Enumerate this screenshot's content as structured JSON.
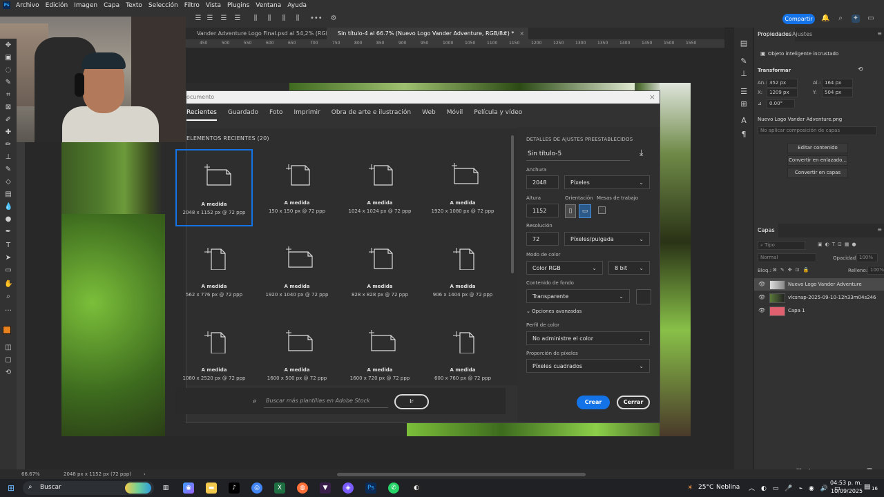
{
  "menubar": {
    "app_icon_label": "Ps",
    "menus": [
      "Archivo",
      "Edición",
      "Imagen",
      "Capa",
      "Texto",
      "Selección",
      "Filtro",
      "Vista",
      "Plugins",
      "Ventana",
      "Ayuda"
    ]
  },
  "options": {
    "share_label": "Compartir"
  },
  "doc_tabs": [
    {
      "label": "Vander Adventure Logo Final.psd al 54,2% (RGB/8#)",
      "active": false
    },
    {
      "label": "Sin título-4 al 66.7% (Nuevo Logo Vander Adventure, RGB/8#) *",
      "active": true
    }
  ],
  "ruler_ticks": [
    "450",
    "500",
    "550",
    "600",
    "650",
    "700",
    "750",
    "800",
    "850",
    "900",
    "950",
    "1000",
    "1050",
    "1100",
    "1150",
    "1200",
    "1250",
    "1300",
    "1350",
    "1400",
    "1450",
    "1500",
    "1550"
  ],
  "dialog": {
    "title": "ocumento",
    "tabs": [
      "Recientes",
      "Guardado",
      "Foto",
      "Imprimir",
      "Obra de arte e ilustración",
      "Web",
      "Móvil",
      "Película y vídeo"
    ],
    "recent_header": "ELEMENTOS RECIENTES",
    "recent_count": "(20)",
    "presets": [
      {
        "name": "A medida",
        "size": "2048 x 1152 px @ 72 ppp",
        "selected": true,
        "shape": "landscape"
      },
      {
        "name": "A medida",
        "size": "150 x 150 px @ 72 ppp",
        "selected": false,
        "shape": "square"
      },
      {
        "name": "A medida",
        "size": "1024 x 1024 px @ 72 ppp",
        "selected": false,
        "shape": "square"
      },
      {
        "name": "A medida",
        "size": "1920 x 1080 px @ 72 ppp",
        "selected": false,
        "shape": "landscape"
      },
      {
        "name": "A medida",
        "size": "562 x 776 px @ 72 ppp",
        "selected": false,
        "shape": "portrait"
      },
      {
        "name": "A medida",
        "size": "1920 x 1040 px @ 72 ppp",
        "selected": false,
        "shape": "landscape"
      },
      {
        "name": "A medida",
        "size": "828 x 828 px @ 72 ppp",
        "selected": false,
        "shape": "square"
      },
      {
        "name": "A medida",
        "size": "906 x 1404 px @ 72 ppp",
        "selected": false,
        "shape": "portrait"
      },
      {
        "name": "A medida",
        "size": "1080 x 2520 px @ 72 ppp",
        "selected": false,
        "shape": "portrait"
      },
      {
        "name": "A medida",
        "size": "1600 x 500 px @ 72 ppp",
        "selected": false,
        "shape": "landscape"
      },
      {
        "name": "A medida",
        "size": "1600 x 720 px @ 72 ppp",
        "selected": false,
        "shape": "landscape"
      },
      {
        "name": "A medida",
        "size": "600 x 760 px @ 72 ppp",
        "selected": false,
        "shape": "portrait"
      }
    ],
    "search_placeholder": "Buscar más plantillas en Adobe Stock",
    "go_label": "Ir",
    "details": {
      "header": "DETALLES DE AJUSTES PREESTABLECIDOS",
      "name": "Sin título-5",
      "width_label": "Anchura",
      "width_value": "2048",
      "width_unit": "Píxeles",
      "height_label": "Altura",
      "height_value": "1152",
      "orientation_label": "Orientación",
      "artboards_label": "Mesas de trabajo",
      "resolution_label": "Resolución",
      "resolution_value": "72",
      "resolution_unit": "Píxeles/pulgada",
      "color_mode_label": "Modo de color",
      "color_mode_value": "Color RGB",
      "bit_depth_value": "8 bit",
      "background_label": "Contenido de fondo",
      "background_value": "Transparente",
      "advanced_label": "Opciones avanzadas",
      "color_profile_label": "Perfil de color",
      "color_profile_value": "No administre el color",
      "pixel_ratio_label": "Proporción de píxeles",
      "pixel_ratio_value": "Píxeles cuadrados",
      "create_label": "Crear",
      "close_label": "Cerrar"
    }
  },
  "properties": {
    "tab_properties": "Propiedades",
    "tab_adjustments": "Ajustes",
    "object_type": "Objeto inteligente incrustado",
    "transform_label": "Transformar",
    "w_label": "An.:",
    "w_value": "352 px",
    "h_label": "Al.:",
    "h_value": "164 px",
    "x_label": "X:",
    "x_value": "1209 px",
    "y_label": "Y:",
    "y_value": "504 px",
    "angle_value": "0.00°",
    "filename": "Nuevo Logo Vander Adventure.png",
    "comp_placeholder": "No aplicar composición de capas",
    "btn_edit": "Editar contenido",
    "btn_convert_linked": "Convertir en enlazado...",
    "btn_convert_layers": "Convertir en capas"
  },
  "layers": {
    "title": "Capas",
    "filter_placeholder": "Tipo",
    "blend_mode": "Normal",
    "opacity_label": "Opacidad:",
    "opacity_value": "100%",
    "lock_label": "Bloq.:",
    "fill_label": "Relleno:",
    "fill_value": "100%",
    "items": [
      {
        "name": "Nuevo Logo Vander Adventure",
        "selected": true
      },
      {
        "name": "vlcsnap-2025-09-10-12h33m04s246",
        "selected": false
      },
      {
        "name": "Capa 1",
        "selected": false
      }
    ]
  },
  "status": {
    "zoom": "66.67%",
    "doc_size": "2048 px x 1152 px (72 ppp)"
  },
  "taskbar": {
    "search_label": "Buscar",
    "weather_temp": "25°C",
    "weather_desc": "Neblina",
    "time": "04:53 p. m.",
    "date": "10/09/2025",
    "notif_count": "16"
  },
  "colors": {
    "accent": "#1473e6",
    "foreground_swatch": "#e8821e",
    "background_swatch": "#ffffff"
  }
}
